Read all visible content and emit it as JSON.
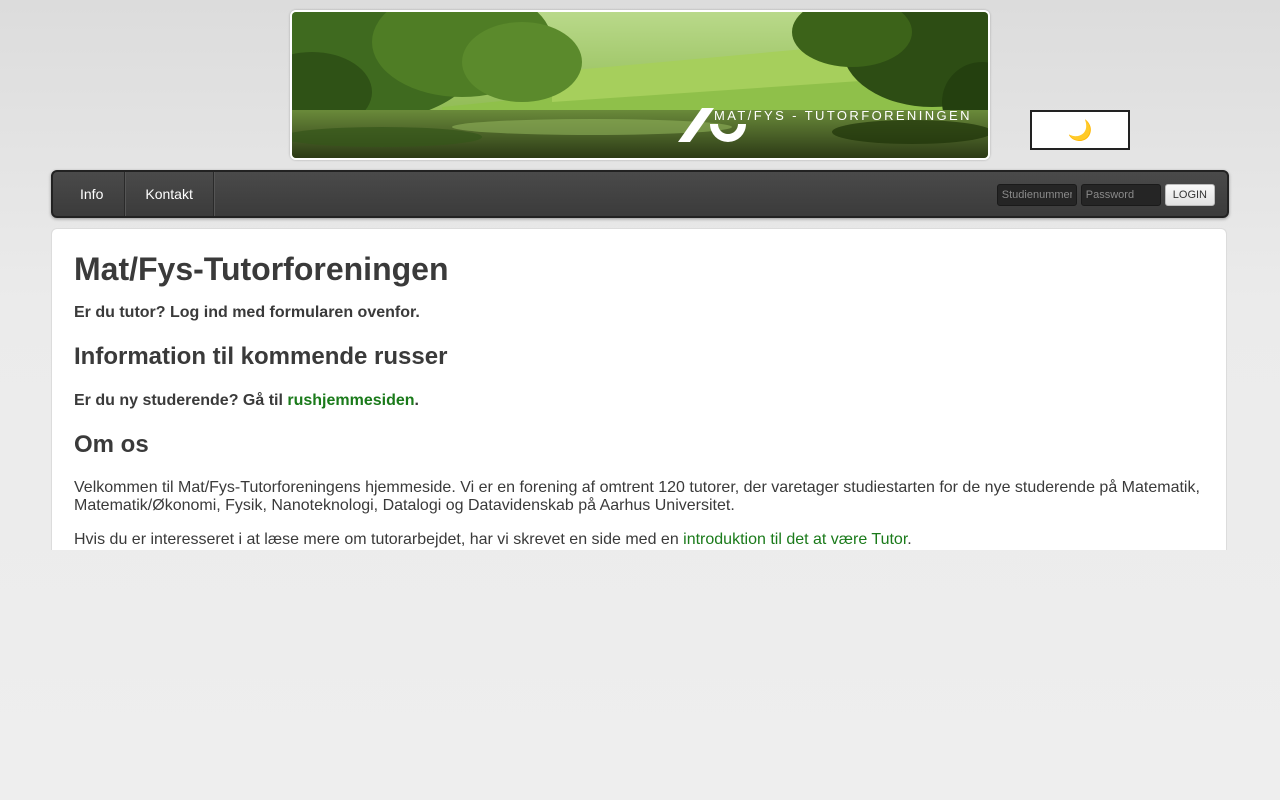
{
  "header": {
    "banner_text": "MAT/FYS - TUTORFORENINGEN",
    "theme_toggle_icon": "moon-icon",
    "theme_toggle_glyph": "🌙"
  },
  "nav": {
    "items": [
      {
        "label": "Info"
      },
      {
        "label": "Kontakt"
      }
    ]
  },
  "login": {
    "username_placeholder": "Studienummer",
    "username_value": "",
    "password_placeholder": "Password",
    "password_value": "",
    "button_label": "LOGIN"
  },
  "main": {
    "title": "Mat/Fys-Tutorforeningen",
    "tutor_line": "Er du tutor? Log ind med formularen ovenfor.",
    "section_russer": {
      "heading": "Information til kommende russer",
      "prefix": "Er du ny studerende? Gå til ",
      "link_text": "rushjemmesiden",
      "suffix": "."
    },
    "section_om_os": {
      "heading": "Om os",
      "paragraph1": "Velkommen til Mat/Fys-Tutorforeningens hjemmeside. Vi er en forening af omtrent 120 tutorer, der varetager studiestarten for de nye studerende på Matematik, Matematik/Økonomi, Fysik, Nanoteknologi, Datalogi og Datavidenskab på Aarhus Universitet.",
      "paragraph2_prefix": "Hvis du er interesseret i at læse mere om tutorarbejdet, har vi skrevet en side med en ",
      "paragraph2_link": "introduktion til det at være Tutor",
      "paragraph2_suffix": "."
    }
  },
  "colors": {
    "link": "#1a7a1a",
    "navbar": "#424242",
    "text": "#3a3a3a",
    "moon": "#f0b400"
  }
}
